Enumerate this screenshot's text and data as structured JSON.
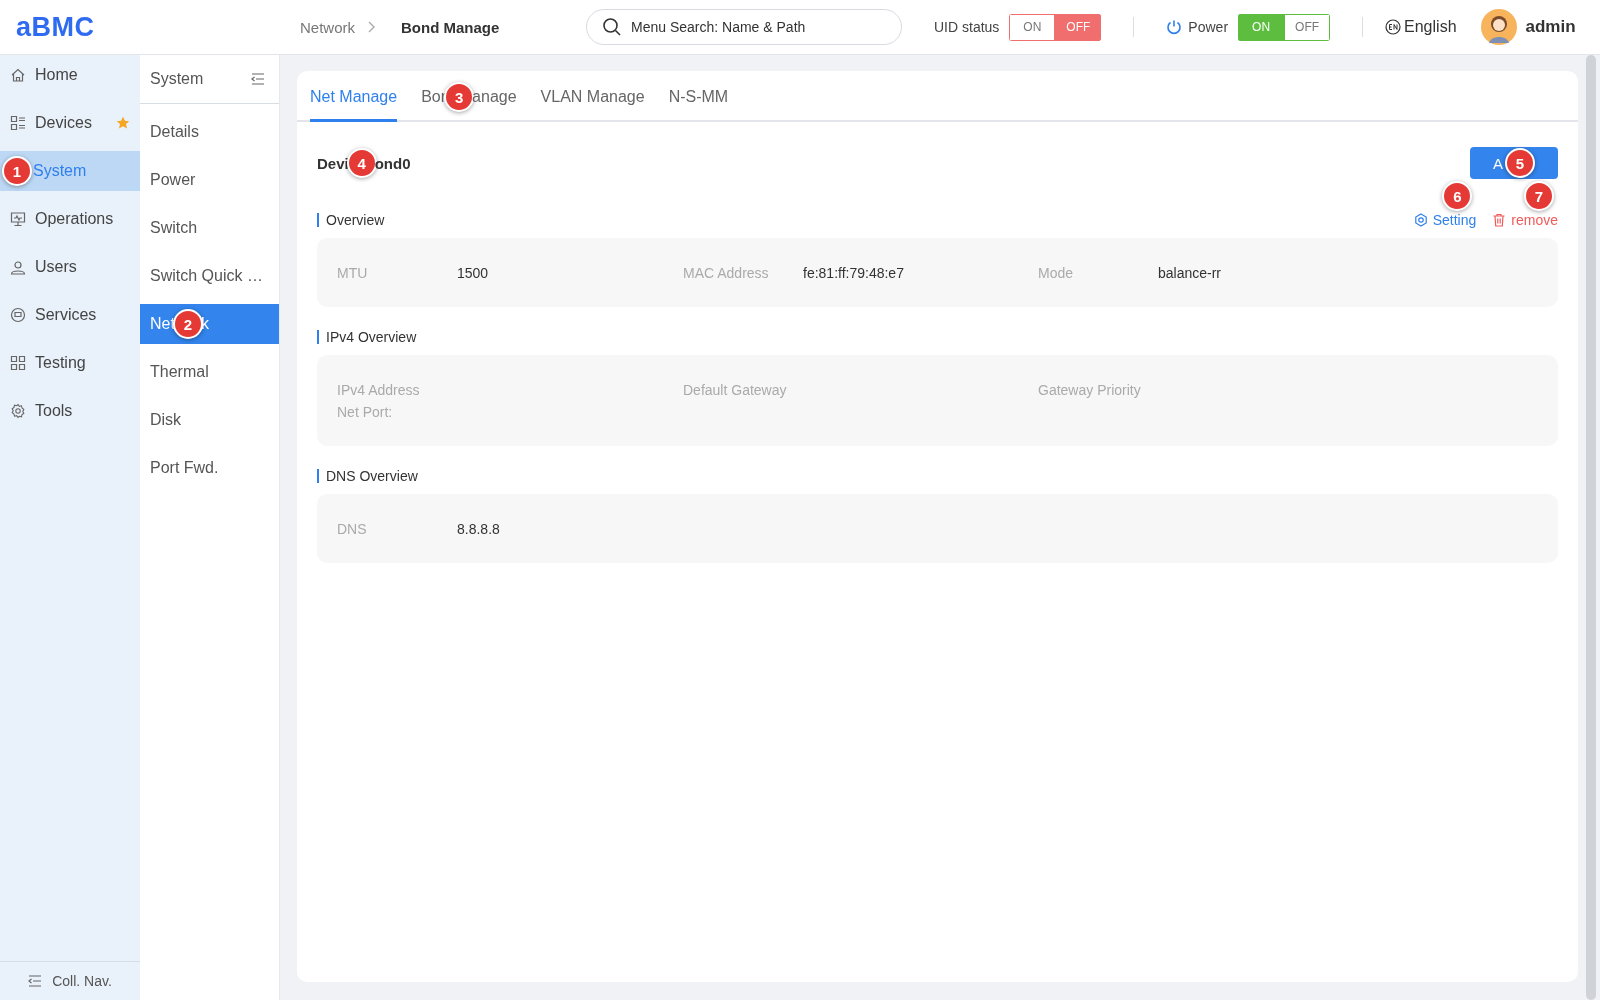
{
  "header": {
    "logo": "aBMC",
    "breadcrumb": [
      {
        "label": "Network"
      },
      {
        "label": "Bond Manage"
      }
    ],
    "search": {
      "placeholder": "Menu Search: Name & Path"
    },
    "switches": [
      {
        "label": "UID status",
        "kind": "danger",
        "options": [
          {
            "label": "ON",
            "selected": false
          },
          {
            "label": "OFF",
            "selected": true
          }
        ]
      },
      {
        "label": "Power",
        "kind": "success",
        "options": [
          {
            "label": "ON",
            "selected": true
          },
          {
            "label": "OFF",
            "selected": false
          }
        ]
      }
    ],
    "language": "English",
    "user": "admin"
  },
  "nav": {
    "items": [
      {
        "label": "Home",
        "selected": false,
        "starred": false
      },
      {
        "label": "Devices",
        "selected": false,
        "starred": true
      },
      {
        "label": "System",
        "selected": true,
        "starred": false,
        "badge": "1"
      },
      {
        "label": "Operations",
        "selected": false,
        "starred": false
      },
      {
        "label": "Users",
        "selected": false,
        "starred": false
      },
      {
        "label": "Services",
        "selected": false,
        "starred": false
      },
      {
        "label": "Testing",
        "selected": false,
        "starred": false
      },
      {
        "label": "Tools",
        "selected": false,
        "starred": false
      }
    ],
    "collapse": "Coll. Nav."
  },
  "subnav": {
    "title": "System",
    "items": [
      {
        "label": "Details",
        "selected": false
      },
      {
        "label": "Power",
        "selected": false
      },
      {
        "label": "Switch",
        "selected": false
      },
      {
        "label": "Switch Quick …",
        "selected": false
      },
      {
        "label_parts": [
          "Net",
          "k"
        ],
        "badge": "2",
        "selected": true
      },
      {
        "label": "Thermal",
        "selected": false
      },
      {
        "label": "Disk",
        "selected": false
      },
      {
        "label": "Port Fwd.",
        "selected": false
      }
    ]
  },
  "tabs": [
    {
      "label": "Net Manage",
      "selected": true
    },
    {
      "label_parts": [
        "Bor",
        "anage"
      ],
      "badge": "3",
      "selected": false
    },
    {
      "label": "VLAN Manage",
      "selected": false
    },
    {
      "label": "N-S-MM",
      "selected": false
    }
  ],
  "device": {
    "title_parts": [
      "Devi",
      "ond0"
    ],
    "badge": "4"
  },
  "add_button": {
    "label_parts": [
      "A"
    ],
    "badge": "5"
  },
  "actions": [
    {
      "label": "Setting",
      "kind": "setting",
      "badge": "6"
    },
    {
      "label": "remove",
      "kind": "danger",
      "badge": "7"
    }
  ],
  "sections": [
    {
      "title": "Overview",
      "fields": [
        {
          "label": "MTU",
          "value": "1500"
        },
        {
          "label": "MAC Address",
          "value": "fe:81:ff:79:48:e7"
        },
        {
          "label": "Mode",
          "value": "balance-rr"
        }
      ]
    },
    {
      "title": "IPv4 Overview",
      "fields": [
        {
          "label": "IPv4 Address"
        },
        {
          "label": "Default Gateway"
        },
        {
          "label": "Gateway Priority"
        }
      ],
      "note": "Net Port:"
    },
    {
      "title": "DNS Overview",
      "fields": [
        {
          "label": "DNS",
          "value": "8.8.8.8"
        }
      ]
    }
  ]
}
